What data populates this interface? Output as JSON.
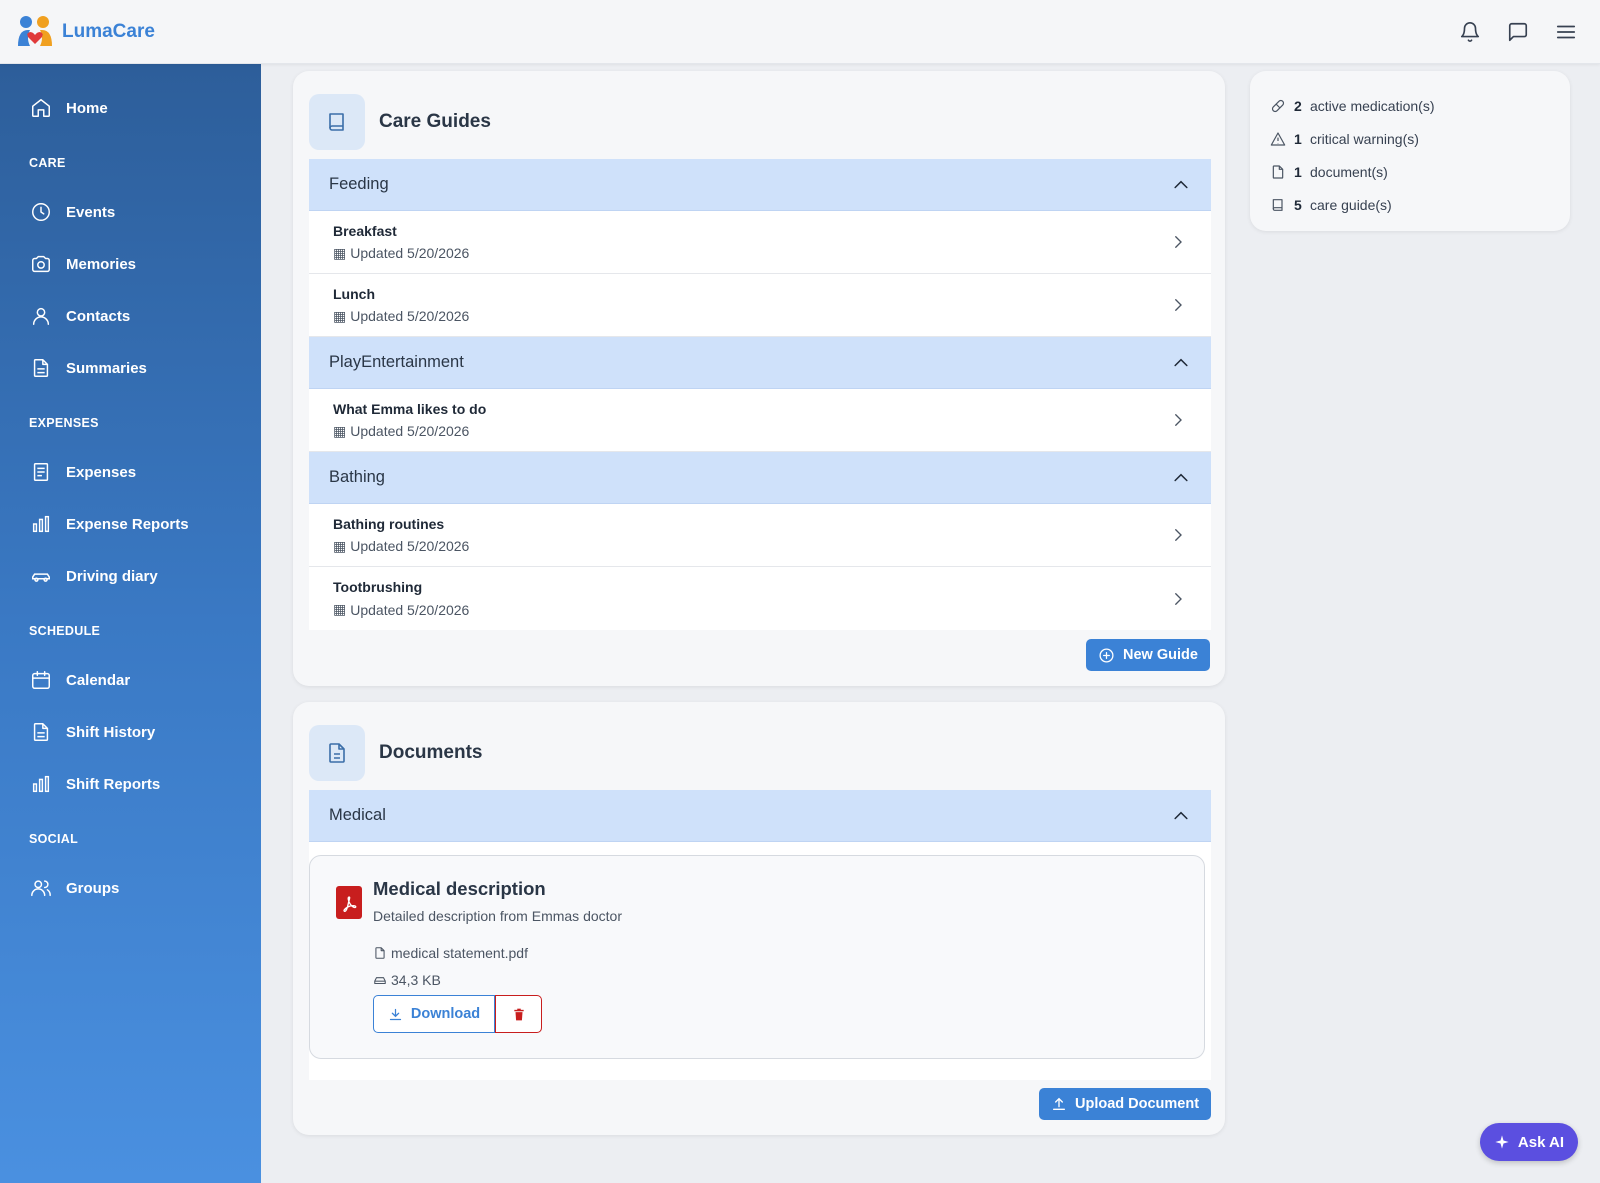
{
  "app": {
    "name": "LumaCare"
  },
  "topbar": {
    "icons": [
      "bell-icon",
      "chat-icon",
      "menu-icon"
    ]
  },
  "sidebar": {
    "home": "Home",
    "sections": {
      "care": "CARE",
      "expenses": "EXPENSES",
      "schedule": "SCHEDULE",
      "social": "SOCIAL"
    },
    "care_items": [
      "Events",
      "Memories",
      "Contacts",
      "Summaries"
    ],
    "expense_items": [
      "Expenses",
      "Expense Reports",
      "Driving diary"
    ],
    "schedule_items": [
      "Calendar",
      "Shift History",
      "Shift Reports"
    ],
    "social_items": [
      "Groups"
    ]
  },
  "care_guides": {
    "title": "Care Guides",
    "groups": [
      {
        "name": "Feeding",
        "items": [
          {
            "title": "Breakfast",
            "updated": "Updated 5/20/2026"
          },
          {
            "title": "Lunch",
            "updated": "Updated 5/20/2026"
          }
        ]
      },
      {
        "name": "PlayEntertainment",
        "items": [
          {
            "title": "What Emma likes to do",
            "updated": "Updated 5/20/2026"
          }
        ]
      },
      {
        "name": "Bathing",
        "items": [
          {
            "title": "Bathing routines",
            "updated": "Updated 5/20/2026"
          },
          {
            "title": "Tootbrushing",
            "updated": "Updated 5/20/2026"
          }
        ]
      }
    ],
    "new_button": "New Guide"
  },
  "documents": {
    "title": "Documents",
    "group": "Medical",
    "doc": {
      "title": "Medical description",
      "description": "Detailed description from Emmas doctor",
      "filename": "medical statement.pdf",
      "size": "34,3 KB",
      "download": "Download"
    },
    "upload_button": "Upload Document"
  },
  "stats": [
    {
      "count": "2",
      "label": "active medication(s)",
      "icon": "pill-icon"
    },
    {
      "count": "1",
      "label": "critical warning(s)",
      "icon": "warning-icon"
    },
    {
      "count": "1",
      "label": "document(s)",
      "icon": "file-icon"
    },
    {
      "count": "5",
      "label": "care guide(s)",
      "icon": "book-icon"
    }
  ],
  "ask_ai": "Ask AI",
  "colors": {
    "accent": "#3b82d6",
    "danger": "#c81e1e",
    "ai": "#5b4fe0",
    "group_bg": "#cfe1fa"
  }
}
